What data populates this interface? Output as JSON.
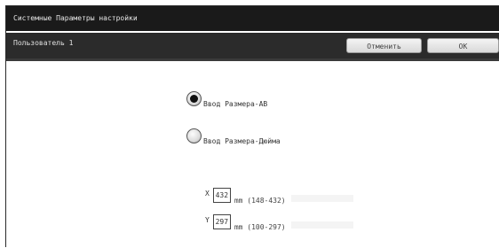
{
  "window": {
    "title": "Системные Параметры настройки"
  },
  "header": {
    "user_label": "Пользователь 1",
    "cancel_label": "Отменить",
    "ok_label": "OK"
  },
  "options": [
    {
      "label": "Ввод Размера-AB",
      "checked": true
    },
    {
      "label": "Ввод Размера-Дюйма",
      "checked": false
    }
  ],
  "fields": {
    "x": {
      "axis": "X",
      "value": "432",
      "range": "mm (148-432)"
    },
    "y": {
      "axis": "Y",
      "value": "297",
      "range": "mm (100-297)"
    }
  },
  "colors": {
    "title_bar": "#1a1a1a",
    "sub_bar": "#2b2b2b",
    "button_face": "#e6e6e6"
  }
}
